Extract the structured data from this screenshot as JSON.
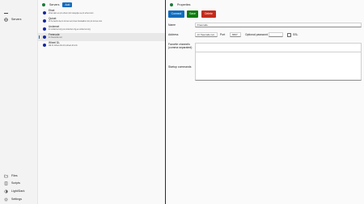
{
  "window": {
    "minimize": "–",
    "maximize": "□",
    "close": "✕"
  },
  "nav": {
    "menu_icon": "hamburger-icon",
    "servers_label": "Servers",
    "files_label": "Files",
    "scripts_label": "Scripts",
    "lightdark_label": "Light/Dark",
    "settings_label": "Settings"
  },
  "servers": {
    "title": "Servers",
    "add_label": "Add",
    "items": [
      {
        "name": "Efnet",
        "address": "efnet.deic.eu,irc.efnet.nl,irc.swepipe.se,irc.efnet.com"
      },
      {
        "name": "Quinet",
        "address": "irc.fu-berlin.de,irc.ircnet.net,ircnet.hostsailor.com,irc.ircnet.com"
      },
      {
        "name": "Undernet",
        "address": "irc.undernet.org,us.undernet.org,eu.undernet.org"
      },
      {
        "name": "Freenode",
        "address": "irc.freenode.net"
      },
      {
        "name": "Wheel DL",
        "address": "dal.irc.wheel-dl.com,wheel-dl.com"
      }
    ],
    "selected_index": 3
  },
  "properties": {
    "title": "Properties",
    "connect_label": "Connect",
    "save_label": "Save",
    "delete_label": "Delete",
    "name_label": "Name",
    "name_value": "Freenode",
    "address_label": "Address",
    "address_value": "irc.freenode.net",
    "port_label": "Port",
    "port_value": "6667",
    "password_label": "Optional password",
    "password_value": "",
    "ssl_label": "SSL",
    "ssl_checked": false,
    "channels_label_1": "Favorite channels",
    "channels_label_2": "(comma separated)",
    "channels_value": "",
    "startup_label": "Startup commands",
    "startup_value": ""
  },
  "colors": {
    "accent": "#0f6cbd",
    "save": "#107c10",
    "delete": "#c42b1c",
    "server_dot": "#1428a0",
    "status_globe": "#1e7a3a"
  }
}
